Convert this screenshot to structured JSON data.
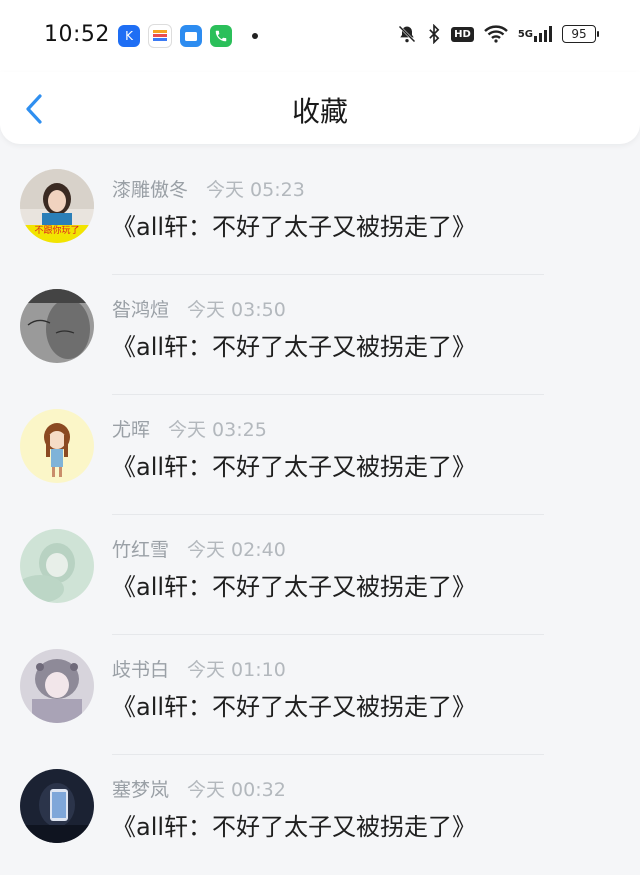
{
  "status_bar": {
    "time": "10:52",
    "app_icons": [
      "kuaishou-icon",
      "wallet-icon",
      "files-icon",
      "phone-icon"
    ],
    "battery": "95",
    "network": "5G",
    "hd_label": "HD"
  },
  "nav": {
    "title": "收藏",
    "back_icon": "chevron-left-icon",
    "accent": "#2f8ff0"
  },
  "favorites": [
    {
      "author": "漆雕傲冬",
      "time": "今天 05:23",
      "title": "《all轩：不好了太子又被拐走了》"
    },
    {
      "author": "昝鸿煊",
      "time": "今天 03:50",
      "title": "《all轩：不好了太子又被拐走了》"
    },
    {
      "author": "尤晖",
      "time": "今天 03:25",
      "title": "《all轩：不好了太子又被拐走了》"
    },
    {
      "author": "竹红雪",
      "time": "今天 02:40",
      "title": "《all轩：不好了太子又被拐走了》"
    },
    {
      "author": "歧书白",
      "time": "今天 01:10",
      "title": "《all轩：不好了太子又被拐走了》"
    },
    {
      "author": "塞梦岚",
      "time": "今天 00:32",
      "title": "《all轩：不好了太子又被拐走了》"
    }
  ],
  "avatar_1_caption": "不跟你玩了"
}
